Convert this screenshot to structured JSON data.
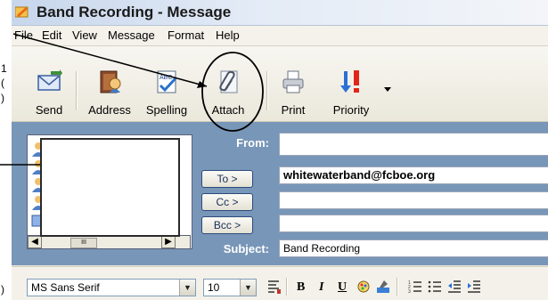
{
  "window": {
    "title": "Band Recording - Message"
  },
  "menu": [
    "File",
    "Edit",
    "View",
    "Message",
    "Format",
    "Help"
  ],
  "toolbar": {
    "send": "Send",
    "address": "Address",
    "spelling": "Spelling",
    "attach": "Attach",
    "print": "Print",
    "priority": "Priority"
  },
  "header": {
    "from_label": "From:",
    "to_button": "To >",
    "cc_button": "Cc >",
    "bcc_button": "Bcc >",
    "subject_label": "Subject:",
    "from_value": "",
    "to_value": "whitewaterband@fcboe.org",
    "cc_value": "",
    "bcc_value": "",
    "subject_value": "Band Recording"
  },
  "format": {
    "font": "MS Sans Serif",
    "size": "10"
  },
  "colors": {
    "header_pane": "#7896b8",
    "titlebar": "#c7d6ec",
    "annotation": "#000000"
  },
  "icons": [
    "send-icon",
    "address-book-icon",
    "spelling-icon",
    "paperclip-icon",
    "printer-icon",
    "priority-icon"
  ]
}
